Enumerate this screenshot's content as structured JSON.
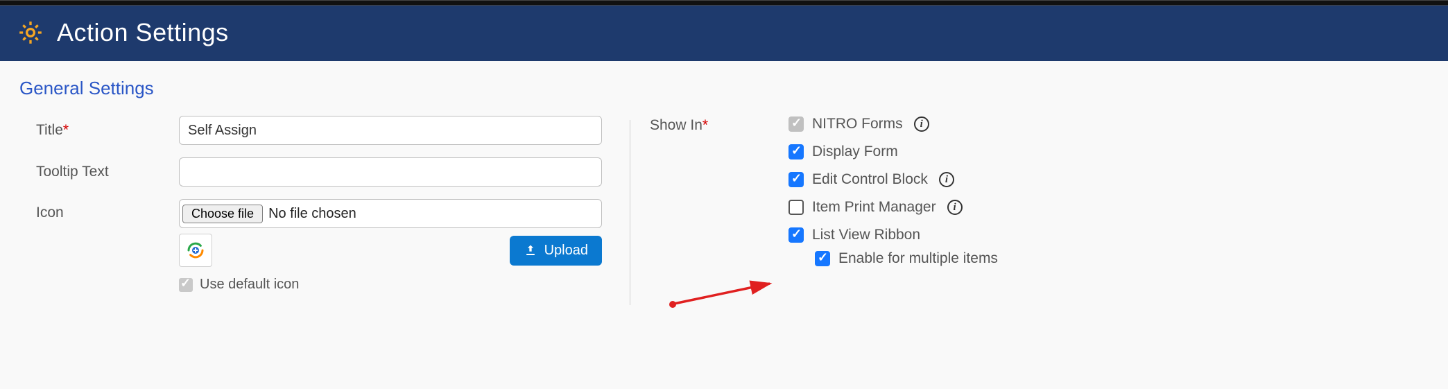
{
  "header": {
    "title": "Action Settings"
  },
  "section": {
    "title": "General Settings"
  },
  "fields": {
    "title_label": "Title",
    "title_value": "Self Assign",
    "tooltip_label": "Tooltip Text",
    "tooltip_value": "",
    "icon_label": "Icon",
    "choose_file_label": "Choose file",
    "file_status": "No file chosen",
    "upload_label": "Upload",
    "use_default_icon_label": "Use default icon"
  },
  "show_in": {
    "label": "Show In",
    "options": {
      "nitro_forms": "NITRO Forms",
      "display_form": "Display Form",
      "edit_control_block": "Edit Control Block",
      "item_print_manager": "Item Print Manager",
      "list_view_ribbon": "List View Ribbon",
      "enable_multiple": "Enable for multiple items"
    }
  }
}
